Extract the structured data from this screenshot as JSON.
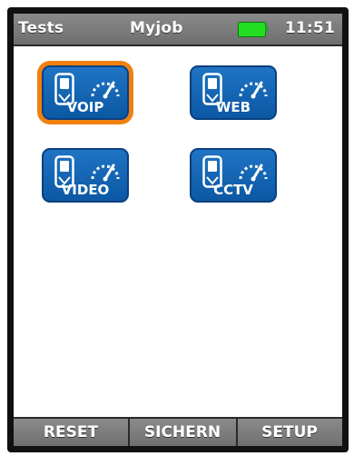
{
  "statusbar": {
    "title": "Tests",
    "job": "Myjob",
    "time": "11:51",
    "battery_icon": "battery-full-icon",
    "battery_color": "#22dd22"
  },
  "tiles": [
    {
      "label": "VOIP",
      "selected": true
    },
    {
      "label": "WEB",
      "selected": false
    },
    {
      "label": "VIDEO",
      "selected": false
    },
    {
      "label": "CCTV",
      "selected": false
    }
  ],
  "tile_icons": [
    "tester-icon",
    "gauge-icon"
  ],
  "colors": {
    "tile": "#1a6bbf",
    "selection": "#f08010",
    "bar": "#7d7d7d"
  },
  "softkeys": {
    "reset": "RESET",
    "sichern": "SICHERN",
    "setup": "SETUP"
  }
}
